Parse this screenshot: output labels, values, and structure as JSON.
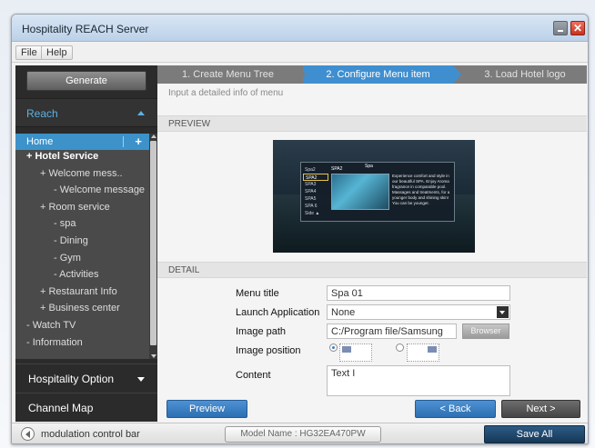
{
  "window": {
    "title": "Hospitality REACH Server"
  },
  "menu": {
    "file": "File",
    "help": "Help"
  },
  "sidebar": {
    "generate_label": "Generate",
    "reach_label": "Reach",
    "tree": {
      "home_label": "Home",
      "home_add": "+",
      "items": [
        {
          "label": "+ Hotel Service",
          "indent": 0,
          "bold": true
        },
        {
          "label": "+ Welcome mess..",
          "indent": 1,
          "bold": false
        },
        {
          "label": "- Welcome message",
          "indent": 2,
          "bold": false
        },
        {
          "label": "+ Room service",
          "indent": 1,
          "bold": false
        },
        {
          "label": "- spa",
          "indent": 2,
          "bold": false
        },
        {
          "label": "- Dining",
          "indent": 2,
          "bold": false
        },
        {
          "label": "- Gym",
          "indent": 2,
          "bold": false
        },
        {
          "label": "- Activities",
          "indent": 2,
          "bold": false
        },
        {
          "label": "+ Restaurant Info",
          "indent": 1,
          "bold": false
        },
        {
          "label": "+ Business center",
          "indent": 1,
          "bold": false
        },
        {
          "label": "- Watch TV",
          "indent": 0,
          "bold": false
        },
        {
          "label": "- Information",
          "indent": 0,
          "bold": false
        }
      ]
    },
    "hospitality_option": "Hospitality Option",
    "channel_map": "Channel Map"
  },
  "steps": [
    {
      "label": "1. Create Menu Tree",
      "active": false
    },
    {
      "label": "2. Configure Menu item",
      "active": true
    },
    {
      "label": "3. Load Hotel logo",
      "active": false
    }
  ],
  "main": {
    "hint": "Input a detailed info of menu",
    "preview_header": "PREVIEW",
    "detail_header": "DETAIL"
  },
  "preview_screen": {
    "title": "Spa",
    "list": [
      "Spa2",
      "SPA2",
      "SPA3",
      "SPA4",
      "SPA5",
      "SPA 6",
      "Side ▲"
    ],
    "selected_index": 1,
    "heading": "SPA2",
    "description": "Experience comfort and style in our beautiful SPA. Enjoy Aroma fragrance in comparable pool. Massages and treatments, for a younger body and shining skin! You can be younger."
  },
  "form": {
    "menu_title": {
      "label": "Menu title",
      "value": "Spa 01"
    },
    "launch_app": {
      "label": "Launch Application",
      "value": "None"
    },
    "image_path": {
      "label": "Image path",
      "value": "C:/Program file/Samsung",
      "browse_label": "Browser"
    },
    "image_position": {
      "label": "Image position",
      "options": [
        "top-left",
        "top-right"
      ],
      "selected": "top-left"
    },
    "content": {
      "label": "Content",
      "value": "Text I"
    }
  },
  "buttons": {
    "preview": "Preview",
    "back": "< Back",
    "next": "Next >"
  },
  "statusbar": {
    "modulation_label": "modulation control bar",
    "model_name": "Model Name : HG32EA470PW",
    "save_all": "Save All"
  },
  "colors": {
    "accent": "#3f8fd0",
    "sidebar_bg": "#2b2b2b",
    "tree_selected": "#3c92c9",
    "reach_label": "#5ab1e6"
  }
}
